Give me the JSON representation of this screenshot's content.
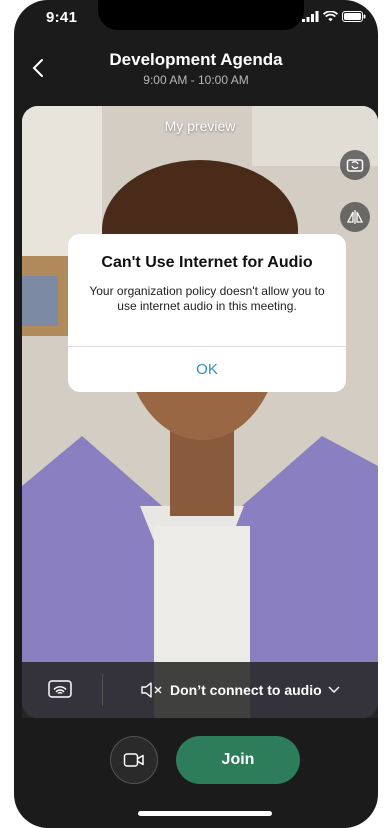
{
  "status_bar": {
    "time": "9:41"
  },
  "header": {
    "title": "Development Agenda",
    "time_range": "9:00 AM - 10:00 AM"
  },
  "preview": {
    "label": "My preview",
    "buttons": [
      "switch-camera-icon",
      "mirror-icon"
    ]
  },
  "dialog": {
    "title": "Can't Use Internet for Audio",
    "message": "Your organization policy doesn't allow you to use internet audio in this meeting.",
    "ok_label": "OK"
  },
  "audio_bar": {
    "audio_option": "Don’t connect to audio"
  },
  "join": {
    "label": "Join"
  },
  "colors": {
    "background": "#1b1b1b",
    "join_button": "#2e7d5a",
    "dialog_link": "#2f8fc4"
  }
}
